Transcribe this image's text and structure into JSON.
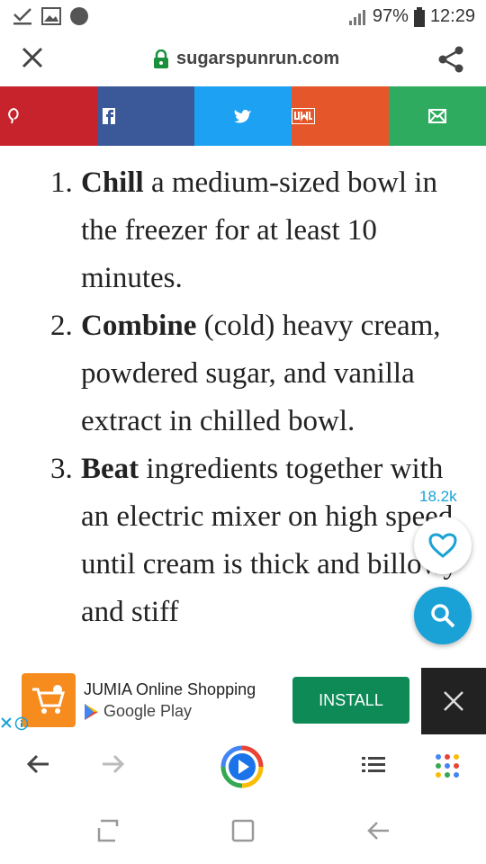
{
  "status_bar": {
    "battery": "97%",
    "time": "12:29"
  },
  "url_bar": {
    "domain": "sugarspunrun.com"
  },
  "share_strip": {
    "colors": [
      "#c7232d",
      "#3b5998",
      "#1da1f2",
      "#e5562a",
      "#2eab5e"
    ],
    "icons": [
      "pinterest-icon",
      "facebook-icon",
      "twitter-icon",
      "yummly-icon",
      "email-icon"
    ]
  },
  "steps": [
    {
      "num": "1.",
      "bold": "Chill",
      "text": " a medium-sized bowl in the freezer for at least 10 minutes."
    },
    {
      "num": "2.",
      "bold": "Combine",
      "text": " (cold) heavy cream, powdered sugar, and vanilla extract in chilled bowl."
    },
    {
      "num": "3.",
      "bold": "Beat",
      "text": " ingredients together with an electric mixer on high speed until cream is thick and billowy and stiff"
    }
  ],
  "favorites_count": "18.2k",
  "ad": {
    "title": "JUMIA Online Shopping",
    "subtitle": "Google Play",
    "install_label": "INSTALL"
  }
}
